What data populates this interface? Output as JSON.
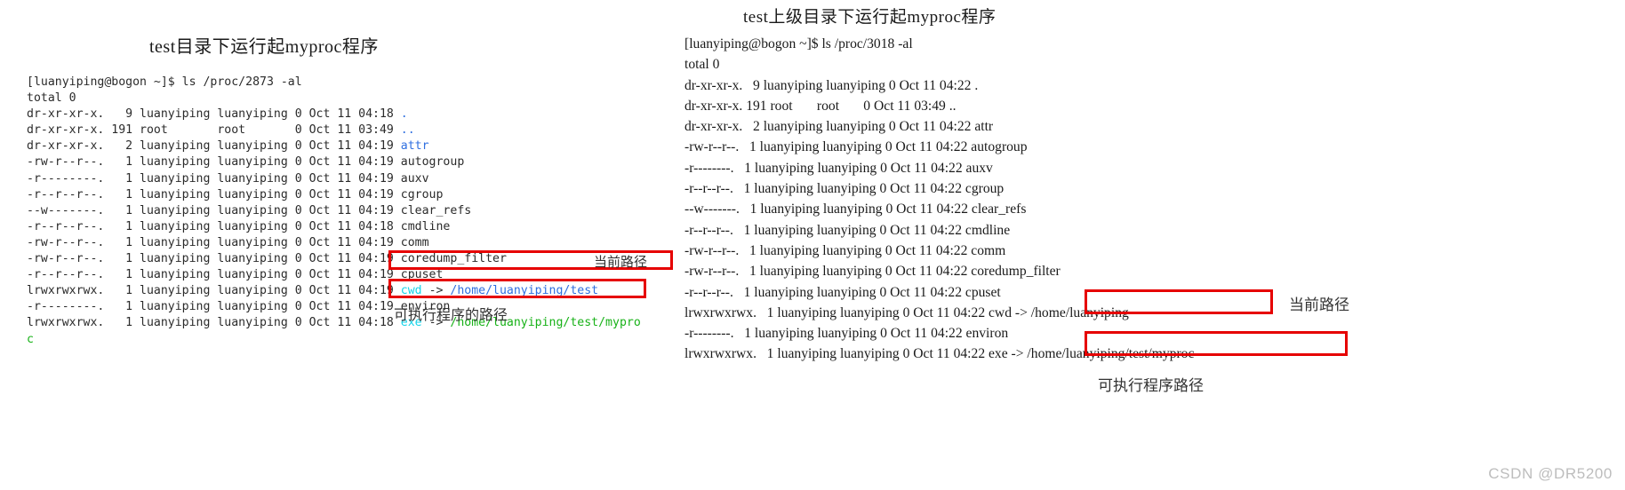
{
  "left": {
    "title": "test目录下运行起myproc程序",
    "prompt": "[luanyiping@bogon ~]$ ls /proc/2873 -al",
    "total": "total 0",
    "rows": [
      {
        "perm": "dr-xr-xr-x.",
        "links": "9",
        "user": "luanyiping",
        "group": "luanyiping",
        "size": "0",
        "date": "Oct 11 04:18",
        "name": ".",
        "color": "dir"
      },
      {
        "perm": "dr-xr-xr-x.",
        "links": "191",
        "user": "root",
        "group": "root",
        "size": "0",
        "date": "Oct 11 03:49",
        "name": "..",
        "color": "dir"
      },
      {
        "perm": "dr-xr-xr-x.",
        "links": "2",
        "user": "luanyiping",
        "group": "luanyiping",
        "size": "0",
        "date": "Oct 11 04:19",
        "name": "attr",
        "color": "dir"
      },
      {
        "perm": "-rw-r--r--.",
        "links": "1",
        "user": "luanyiping",
        "group": "luanyiping",
        "size": "0",
        "date": "Oct 11 04:19",
        "name": "autogroup",
        "color": "plain"
      },
      {
        "perm": "-r--------.",
        "links": "1",
        "user": "luanyiping",
        "group": "luanyiping",
        "size": "0",
        "date": "Oct 11 04:19",
        "name": "auxv",
        "color": "plain"
      },
      {
        "perm": "-r--r--r--.",
        "links": "1",
        "user": "luanyiping",
        "group": "luanyiping",
        "size": "0",
        "date": "Oct 11 04:19",
        "name": "cgroup",
        "color": "plain"
      },
      {
        "perm": "--w-------.",
        "links": "1",
        "user": "luanyiping",
        "group": "luanyiping",
        "size": "0",
        "date": "Oct 11 04:19",
        "name": "clear_refs",
        "color": "plain"
      },
      {
        "perm": "-r--r--r--.",
        "links": "1",
        "user": "luanyiping",
        "group": "luanyiping",
        "size": "0",
        "date": "Oct 11 04:18",
        "name": "cmdline",
        "color": "plain"
      },
      {
        "perm": "-rw-r--r--.",
        "links": "1",
        "user": "luanyiping",
        "group": "luanyiping",
        "size": "0",
        "date": "Oct 11 04:19",
        "name": "comm",
        "color": "plain"
      },
      {
        "perm": "-rw-r--r--.",
        "links": "1",
        "user": "luanyiping",
        "group": "luanyiping",
        "size": "0",
        "date": "Oct 11 04:19",
        "name": "coredump_filter",
        "color": "plain"
      },
      {
        "perm": "-r--r--r--.",
        "links": "1",
        "user": "luanyiping",
        "group": "luanyiping",
        "size": "0",
        "date": "Oct 11 04:19",
        "name": "cpuset",
        "color": "plain"
      },
      {
        "perm": "lrwxrwxrwx.",
        "links": "1",
        "user": "luanyiping",
        "group": "luanyiping",
        "size": "0",
        "date": "Oct 11 04:19",
        "name": "cwd",
        "color": "link",
        "target": "/home/luanyiping/test",
        "target_color": "blue"
      },
      {
        "perm": "-r--------.",
        "links": "1",
        "user": "luanyiping",
        "group": "luanyiping",
        "size": "0",
        "date": "Oct 11 04:19",
        "name": "environ",
        "color": "plain"
      },
      {
        "perm": "lrwxrwxrwx.",
        "links": "1",
        "user": "luanyiping",
        "group": "luanyiping",
        "size": "0",
        "date": "Oct 11 04:18",
        "name": "exe",
        "color": "link",
        "target": "/home/luanyiping/test/mypro",
        "target_color": "green"
      }
    ],
    "wrap_char": "c",
    "annotations": {
      "cwd": "当前路径",
      "exe": "可执行程序的路径"
    }
  },
  "right": {
    "title": "test上级目录下运行起myproc程序",
    "prompt": "[luanyiping@bogon ~]$ ls /proc/3018 -al",
    "total": "total 0",
    "rows": [
      {
        "perm": "dr-xr-xr-x.",
        "links": "9",
        "user": "luanyiping",
        "group": "luanyiping",
        "size": "0",
        "date": "Oct 11 04:22",
        "name": "."
      },
      {
        "perm": "dr-xr-xr-x.",
        "links": "191",
        "user": "root",
        "group": "root",
        "size": "0",
        "date": "Oct 11 03:49",
        "name": ".."
      },
      {
        "perm": "dr-xr-xr-x.",
        "links": "2",
        "user": "luanyiping",
        "group": "luanyiping",
        "size": "0",
        "date": "Oct 11 04:22",
        "name": "attr"
      },
      {
        "perm": "-rw-r--r--.",
        "links": "1",
        "user": "luanyiping",
        "group": "luanyiping",
        "size": "0",
        "date": "Oct 11 04:22",
        "name": "autogroup"
      },
      {
        "perm": "-r--------.",
        "links": "1",
        "user": "luanyiping",
        "group": "luanyiping",
        "size": "0",
        "date": "Oct 11 04:22",
        "name": "auxv"
      },
      {
        "perm": "-r--r--r--.",
        "links": "1",
        "user": "luanyiping",
        "group": "luanyiping",
        "size": "0",
        "date": "Oct 11 04:22",
        "name": "cgroup"
      },
      {
        "perm": "--w-------.",
        "links": "1",
        "user": "luanyiping",
        "group": "luanyiping",
        "size": "0",
        "date": "Oct 11 04:22",
        "name": "clear_refs"
      },
      {
        "perm": "-r--r--r--.",
        "links": "1",
        "user": "luanyiping",
        "group": "luanyiping",
        "size": "0",
        "date": "Oct 11 04:22",
        "name": "cmdline"
      },
      {
        "perm": "-rw-r--r--.",
        "links": "1",
        "user": "luanyiping",
        "group": "luanyiping",
        "size": "0",
        "date": "Oct 11 04:22",
        "name": "comm"
      },
      {
        "perm": "-rw-r--r--.",
        "links": "1",
        "user": "luanyiping",
        "group": "luanyiping",
        "size": "0",
        "date": "Oct 11 04:22",
        "name": "coredump_filter"
      },
      {
        "perm": "-r--r--r--.",
        "links": "1",
        "user": "luanyiping",
        "group": "luanyiping",
        "size": "0",
        "date": "Oct 11 04:22",
        "name": "cpuset"
      },
      {
        "perm": "lrwxrwxrwx.",
        "links": "1",
        "user": "luanyiping",
        "group": "luanyiping",
        "size": "0",
        "date": "Oct 11 04:22",
        "name": "cwd -> /home/luanyiping"
      },
      {
        "perm": "-r--------.",
        "links": "1",
        "user": "luanyiping",
        "group": "luanyiping",
        "size": "0",
        "date": "Oct 11 04:22",
        "name": "environ"
      },
      {
        "perm": "lrwxrwxrwx.",
        "links": "1",
        "user": "luanyiping",
        "group": "luanyiping",
        "size": "0",
        "date": "Oct 11 04:22",
        "name": "exe -> /home/luanyiping/test/myproc"
      }
    ],
    "annotations": {
      "cwd": "当前路径",
      "exe": "可执行程序路径"
    }
  },
  "watermark": "CSDN @DR5200",
  "colors": {
    "highlight_box": "#e60000",
    "dir": "#2f6fe0",
    "symlink_name": "#14d3e8",
    "symlink_target_blue": "#2f6fe0",
    "symlink_target_green": "#18b218",
    "text": "#2b2b2b"
  }
}
